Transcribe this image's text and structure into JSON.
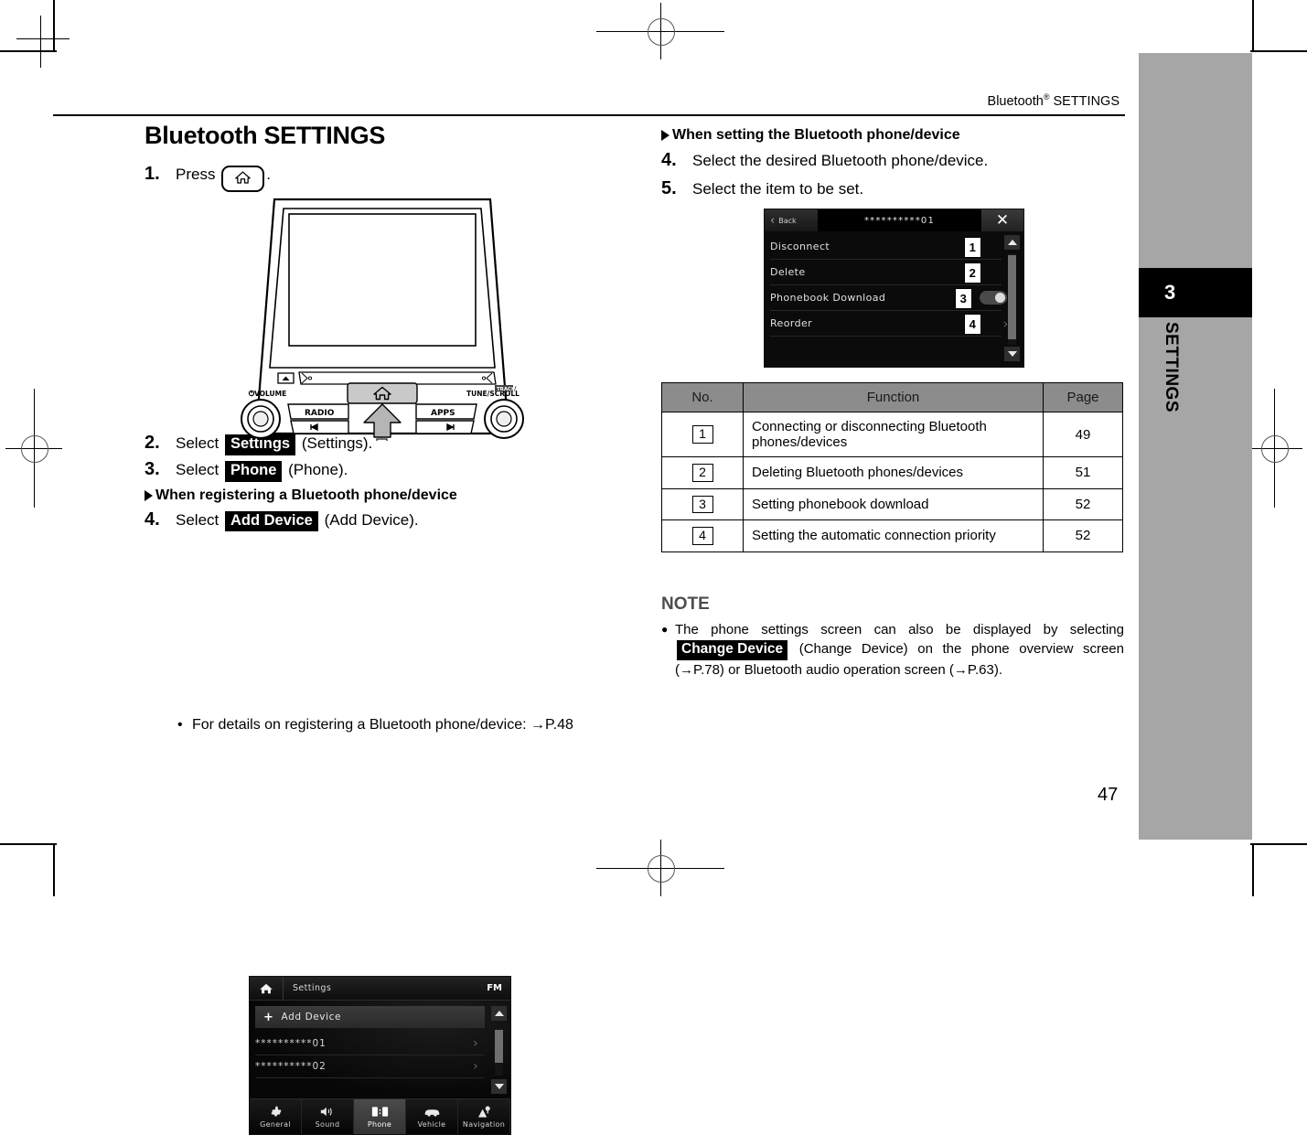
{
  "header": {
    "running_head": "Bluetooth® SETTINGS",
    "page_number": "47"
  },
  "chapter_tab": {
    "number": "3",
    "label": "SETTINGS"
  },
  "left_column": {
    "title": "Bluetooth SETTINGS",
    "step1": {
      "num": "1.",
      "before": "Press",
      "after": "."
    },
    "step2": {
      "num": "2.",
      "before": "Select",
      "key": "Settings",
      "after": "(Settings)."
    },
    "step3": {
      "num": "3.",
      "before": "Select",
      "key": "Phone",
      "after": "(Phone)."
    },
    "subhead_register": "When registering a Bluetooth phone/device",
    "step4": {
      "num": "4.",
      "before": "Select",
      "key": "Add Device",
      "after": "(Add Device)."
    },
    "bullet": "For details on registering a Bluetooth phone/device: →P.48"
  },
  "head_unit": {
    "volume_label": "VOLUME",
    "radio_label": "RADIO",
    "apps_label": "APPS",
    "tune_label": "TUNE/SCROLL",
    "tune_sub": "TRACK"
  },
  "settings_screen": {
    "title": "Settings",
    "radio_band": "FM",
    "add_device": "Add Device",
    "devices": [
      "**********01",
      "**********02"
    ],
    "tabs": [
      {
        "label": "General",
        "icon": "gear-icon"
      },
      {
        "label": "Sound",
        "icon": "speaker-icon"
      },
      {
        "label": "Phone",
        "icon": "phone-devices-icon",
        "active": true
      },
      {
        "label": "Vehicle",
        "icon": "car-icon"
      },
      {
        "label": "Navigation",
        "icon": "map-pin-icon"
      }
    ]
  },
  "right_column": {
    "subhead_setting": "When setting the Bluetooth phone/device",
    "step4": {
      "num": "4.",
      "text": "Select the desired Bluetooth phone/device."
    },
    "step5": {
      "num": "5.",
      "text": "Select the item to be set."
    }
  },
  "device_screen": {
    "back_label": "Back",
    "title": "**********01",
    "close_icon": "close-icon",
    "items": [
      {
        "label": "Disconnect",
        "callout": "1"
      },
      {
        "label": "Delete",
        "callout": "2"
      },
      {
        "label": "Phonebook Download",
        "callout": "3",
        "control": "toggle-on"
      },
      {
        "label": "Reorder",
        "callout": "4",
        "control": "chevron-right"
      }
    ]
  },
  "function_table": {
    "headers": [
      "No.",
      "Function",
      "Page"
    ],
    "rows": [
      {
        "no": "1",
        "function": "Connecting or disconnecting Bluetooth phones/devices",
        "page": "49"
      },
      {
        "no": "2",
        "function": "Deleting Bluetooth phones/devices",
        "page": "51"
      },
      {
        "no": "3",
        "function": "Setting phonebook download",
        "page": "52"
      },
      {
        "no": "4",
        "function": "Setting the automatic connection priority",
        "page": "52"
      }
    ]
  },
  "note": {
    "heading": "NOTE",
    "text_part1": "The phone settings screen can also be displayed by selecting",
    "key": "Change Device",
    "text_part2": "(Change Device) on the phone overview screen (→P.78) or Bluetooth audio operation screen (→P.63)."
  }
}
